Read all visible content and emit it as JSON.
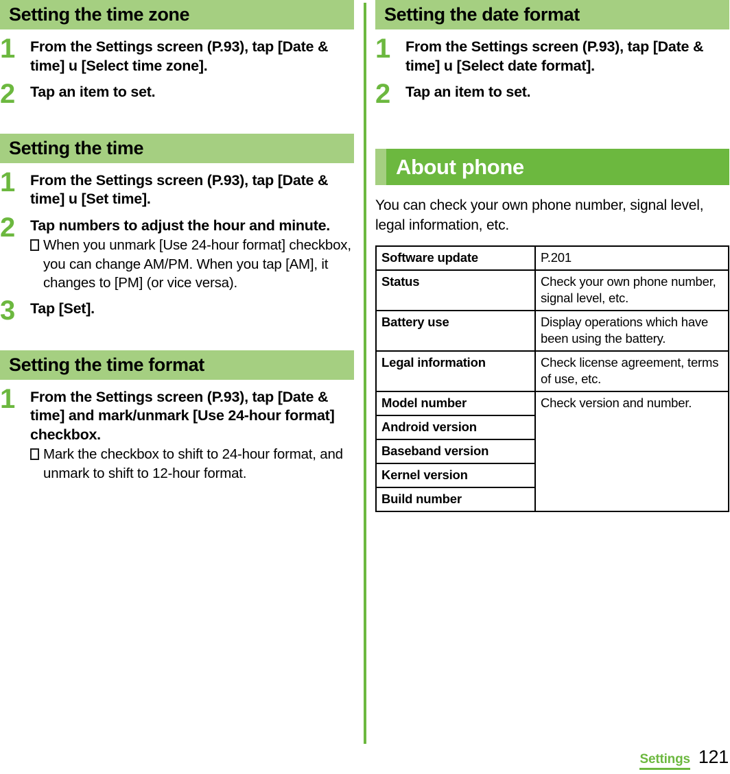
{
  "colors": {
    "banner_light_green": "#a5cf81",
    "banner_dark_green": "#6cb83f",
    "step_number_green": "#6cb83f",
    "text_black": "#000000",
    "banner_text_white": "#ffffff"
  },
  "left_column": {
    "sections": [
      {
        "title": "Setting the time zone",
        "steps": [
          {
            "number": "1",
            "text": "From the Settings screen (P.93), tap [Date & time] u  [Select time zone].",
            "notes": []
          },
          {
            "number": "2",
            "text": "Tap an item to set.",
            "notes": []
          }
        ]
      },
      {
        "title": "Setting the time",
        "steps": [
          {
            "number": "1",
            "text": "From the Settings screen (P.93), tap [Date & time] u  [Set time].",
            "notes": []
          },
          {
            "number": "2",
            "text": "Tap numbers to adjust the hour and minute.",
            "notes": [
              "When you unmark [Use 24-hour format] checkbox, you can change AM/PM. When you tap [AM], it changes to [PM] (or vice versa)."
            ]
          },
          {
            "number": "3",
            "text": "Tap [Set].",
            "notes": []
          }
        ]
      },
      {
        "title": "Setting the time format",
        "steps": [
          {
            "number": "1",
            "text": "From the Settings screen (P.93), tap [Date & time] and mark/unmark [Use 24-hour format] checkbox.",
            "notes": [
              "Mark the checkbox to shift to 24-hour format, and unmark to shift to 12-hour format."
            ]
          }
        ]
      }
    ]
  },
  "right_column": {
    "sections": [
      {
        "title": "Setting the date format",
        "steps": [
          {
            "number": "1",
            "text": "From the Settings screen (P.93), tap [Date & time] u  [Select date format].",
            "notes": []
          },
          {
            "number": "2",
            "text": "Tap an item to set.",
            "notes": []
          }
        ]
      }
    ],
    "chapter": {
      "title": "About phone",
      "intro": "You can check your own phone number, signal level, legal information, etc.",
      "table": {
        "rows": [
          {
            "key": "Software update",
            "value": "P.201"
          },
          {
            "key": "Status",
            "value": "Check your own phone number, signal level, etc."
          },
          {
            "key": "Battery use",
            "value": "Display operations which have been using the battery."
          },
          {
            "key": "Legal information",
            "value": "Check license agreement, terms of use, etc."
          },
          {
            "key": "Model number",
            "value": "Check version and number."
          },
          {
            "key": "Android version",
            "value": ""
          },
          {
            "key": "Baseband version",
            "value": ""
          },
          {
            "key": "Kernel version",
            "value": ""
          },
          {
            "key": "Build number",
            "value": ""
          }
        ]
      }
    }
  },
  "footer": {
    "label": "Settings",
    "page_number": "121"
  }
}
